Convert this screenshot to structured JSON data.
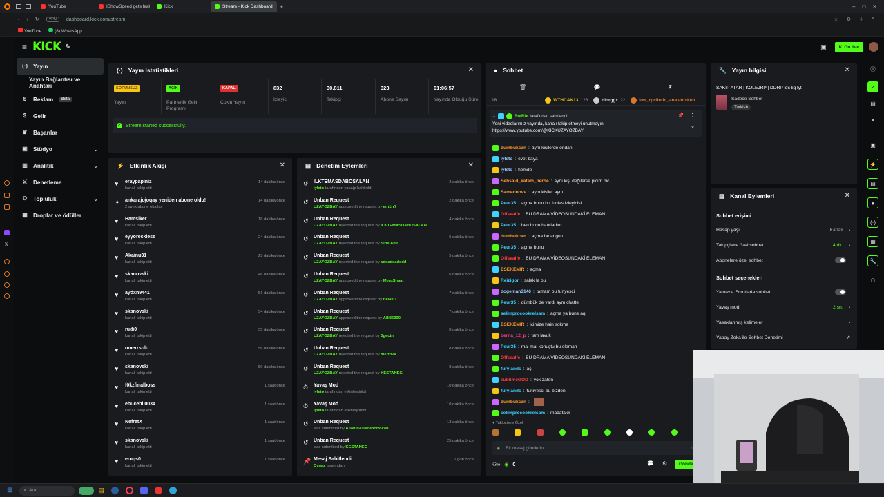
{
  "browser": {
    "tabs": [
      {
        "label": "YouTube",
        "color": "#ff3030"
      },
      {
        "label": "IShowSpeed gets leaked",
        "color": "#ff3030"
      },
      {
        "label": "Kick",
        "color": "#53fc18"
      },
      {
        "label": "Stream - Kick Dashboard",
        "color": "#53fc18"
      }
    ],
    "url": "dashboard.kick.com/stream",
    "bookmarks": [
      "YouTube",
      "(8) WhatsApp"
    ]
  },
  "header": {
    "logo": "KICK",
    "go_live": "Go live"
  },
  "sidebar": {
    "items": [
      {
        "label": "Yayın",
        "icon": "broadcast-icon"
      },
      {
        "label": "Yayın Bağlantısı ve Anahtarı",
        "icon": ""
      },
      {
        "label": "Reklam",
        "icon": "dollar-icon",
        "badge": "Beta"
      },
      {
        "label": "Gelir",
        "icon": "dollar-icon"
      },
      {
        "label": "Başarılar",
        "icon": "trophy-icon"
      },
      {
        "label": "Stüdyo",
        "icon": "studio-icon",
        "chevron": true
      },
      {
        "label": "Analitik",
        "icon": "chart-icon",
        "chevron": true
      },
      {
        "label": "Denetleme",
        "icon": "sword-icon"
      },
      {
        "label": "Topluluk",
        "icon": "people-icon",
        "chevron": true
      },
      {
        "label": "Droplar ve ödüller",
        "icon": "gift-icon"
      }
    ]
  },
  "stats": {
    "title": "Yayın İstatistikleri",
    "items": [
      {
        "badge": "SORUNSUZ",
        "badge_color": "#f5c518",
        "badge_text": "#6b4f00",
        "label": "Yayın"
      },
      {
        "badge": "AÇIK",
        "badge_color": "#53fc18",
        "badge_text": "#0b3a00",
        "label": "Partnerlik Gelir Programı"
      },
      {
        "badge": "KAPALI",
        "badge_color": "#e03030",
        "badge_text": "#ffffff",
        "label": "Çoklu Yayın"
      },
      {
        "value": "832",
        "label": "İzleyici"
      },
      {
        "value": "30.811",
        "label": "Takipçi"
      },
      {
        "value": "323",
        "label": "Abone Sayısı"
      },
      {
        "value": "01:06:57",
        "label": "Yayında Olduğu Süre"
      }
    ],
    "success": "Stream started successfully."
  },
  "activity": {
    "title": "Etkinlik Akışı",
    "rows": [
      {
        "name": "eraypapiniz",
        "sub": "kanalı takip etti",
        "time": "14 dakika önce",
        "icon": "heart"
      },
      {
        "name": "ankarajojoqay yeniden abone oldu!",
        "sub": "2 aylık abone oldular",
        "time": "14 dakika önce",
        "icon": "star"
      },
      {
        "name": "Hamsiker",
        "sub": "kanalı takip etti",
        "time": "18 dakika önce",
        "icon": "heart"
      },
      {
        "name": "eyyoreckless",
        "sub": "kanalı takip etti",
        "time": "24 dakika önce",
        "icon": "heart"
      },
      {
        "name": "Akainu31",
        "sub": "kanalı takip etti",
        "time": "25 dakika önce",
        "icon": "heart"
      },
      {
        "name": "skanovski",
        "sub": "kanalı takip etti",
        "time": "46 dakika önce",
        "icon": "heart"
      },
      {
        "name": "aydxn9441",
        "sub": "kanalı takip etti",
        "time": "51 dakika önce",
        "icon": "heart"
      },
      {
        "name": "skanovski",
        "sub": "kanalı takip etti",
        "time": "54 dakika önce",
        "icon": "heart"
      },
      {
        "name": "rudi0",
        "sub": "kanalı takip etti",
        "time": "55 dakika önce",
        "icon": "heart"
      },
      {
        "name": "omerrsolo",
        "sub": "kanalı takip etti",
        "time": "56 dakika önce",
        "icon": "heart"
      },
      {
        "name": "skanovski",
        "sub": "kanalı takip etti",
        "time": "59 dakika önce",
        "icon": "heart"
      },
      {
        "name": "f0kzfinalboss",
        "sub": "kanalı takip etti",
        "time": "1 saat önce",
        "icon": "heart"
      },
      {
        "name": "ebucehil0034",
        "sub": "kanalı takip etti",
        "time": "1 saat önce",
        "icon": "heart"
      },
      {
        "name": "NefretX",
        "sub": "kanalı takip etti",
        "time": "1 saat önce",
        "icon": "heart"
      },
      {
        "name": "skanovski",
        "sub": "kanalı takip etti",
        "time": "1 saat önce",
        "icon": "heart"
      },
      {
        "name": "eroqs0",
        "sub": "kanalı takip etti",
        "time": "1 saat önce",
        "icon": "heart"
      }
    ]
  },
  "moderation": {
    "title": "Denetim Eylemleri",
    "rows": [
      {
        "name": "ILKTEMASDABOSALAN",
        "who": "iyleto",
        "rest": "tarafından yasağı kaldırıldı",
        "by": "",
        "time": "2 dakika önce"
      },
      {
        "name": "Unban Request",
        "who": "UZAYOZBAY",
        "rest": "approved the request by",
        "by": "em1rr7",
        "time": "2 dakika önce"
      },
      {
        "name": "Unban Request",
        "who": "UZAYOZBAY",
        "rest": "rejected the request by",
        "by": "ILKTEMASDABOSALAN",
        "time": "4 dakika önce"
      },
      {
        "name": "Unban Request",
        "who": "UZAYOZBAY",
        "rest": "rejected the request by",
        "by": "SinsiAbe",
        "time": "5 dakika önce"
      },
      {
        "name": "Unban Request",
        "who": "UZAYOZBAY",
        "rest": "rejected the request by",
        "by": "sdsadsadsdd",
        "time": "5 dakika önce"
      },
      {
        "name": "Unban Request",
        "who": "UZAYOZBAY",
        "rest": "approved the request by",
        "by": "MeruShaat",
        "time": "6 dakika önce"
      },
      {
        "name": "Unban Request",
        "who": "UZAYOZBAY",
        "rest": "approved the request by",
        "by": "belalil1",
        "time": "7 dakika önce"
      },
      {
        "name": "Unban Request",
        "who": "UZAYOZBAY",
        "rest": "approved the request by",
        "by": "Alli35390",
        "time": "7 dakika önce"
      },
      {
        "name": "Unban Request",
        "who": "UZAYOZBAY",
        "rest": "rejected the request by",
        "by": "3gectn",
        "time": "8 dakika önce"
      },
      {
        "name": "Unban Request",
        "who": "UZAYOZBAY",
        "rest": "rejected the request by",
        "by": "mertb24",
        "time": "8 dakika önce"
      },
      {
        "name": "Unban Request",
        "who": "UZAYOZBAY",
        "rest": "rejected the request by",
        "by": "KESTANEG",
        "time": "8 dakika önce"
      },
      {
        "name": "Yavaş Mod",
        "who": "iyleto",
        "rest": "tarafından etkinleştirildi",
        "by": "",
        "time": "10 dakika önce"
      },
      {
        "name": "Yavaş Mod",
        "who": "iyleto",
        "rest": "tarafından etkinleştirildi",
        "by": "",
        "time": "10 dakika önce"
      },
      {
        "name": "Unban Request",
        "who": "",
        "rest": "was submitted by",
        "by": "AllahinAslaniBortocan",
        "time": "13 dakika önce"
      },
      {
        "name": "Unban Request",
        "who": "",
        "rest": "was submitted by",
        "by": "KESTANEG",
        "time": "25 dakika önce"
      },
      {
        "name": "Mesaj Sabitlendi",
        "who": "Cynaz",
        "rest": "tarafından",
        "by": "",
        "time": "1 gün önce"
      }
    ]
  },
  "chat": {
    "title": "Sohbet",
    "count": "18",
    "top_users": [
      {
        "name": "WTHCAN13",
        "n": "126"
      },
      {
        "name": "diorggx",
        "n": "22"
      },
      {
        "name": "low_rpcilerin_anasinisken",
        "n": ""
      }
    ],
    "pinned": {
      "by": "BotRix",
      "by_text": "tarafından sabitlendi",
      "text": "Yeni videolarımız yayında, kanalı takip etmeyi unutmayın!",
      "link": "https://www.youtube.com/@KICKUZAYOZBAY"
    },
    "messages": [
      {
        "name": "dumbukcan",
        "color": "#ff9d2e",
        "text": "aynı kişilerde ondan"
      },
      {
        "name": "iyleto",
        "color": "#9ecbff",
        "text": "evet baya"
      },
      {
        "name": "iyleto",
        "color": "#9ecbff",
        "text": "hemde"
      },
      {
        "name": "Sehsaid_kafam_nerde",
        "color": "#ff9d2e",
        "text": "aynı kişi değilerse picim pic"
      },
      {
        "name": "Samedoovv",
        "color": "#ff9d2e",
        "text": "aynı kişiler aynı"
      },
      {
        "name": "Peur35",
        "color": "#3fd1ff",
        "text": "açma bunu bu funies izleyicisi"
      },
      {
        "name": "Offsealfe",
        "color": "#ff3c3c",
        "text": "BU DRAMA VİDEOSUNDAKİ ELEMAN"
      },
      {
        "name": "Peur35",
        "color": "#3fd1ff",
        "text": "ben bunu hatırladım"
      },
      {
        "name": "dumbukcan",
        "color": "#ff9d2e",
        "text": "açma be angutu"
      },
      {
        "name": "Peur35",
        "color": "#3fd1ff",
        "text": "açma bunu"
      },
      {
        "name": "Offsealfe",
        "color": "#ff3c3c",
        "text": "BU DRAMA VİDEOSUNDAKİ ELEMAN"
      },
      {
        "name": "ESEKEMIR",
        "color": "#ff9d2e",
        "text": "açma"
      },
      {
        "name": "Reizigor",
        "color": "#3fd1ff",
        "text": "salak la bu"
      },
      {
        "name": "dogeman3146",
        "color": "#9ecbff",
        "text": "tamam bu funyesci"
      },
      {
        "name": "Peur35",
        "color": "#3fd1ff",
        "text": "dümbük de vardı aynı chatte"
      },
      {
        "name": "selimprocookrelsam",
        "color": "#3fd1ff",
        "text": "açma ya bune aq"
      },
      {
        "name": "ESEKEMIR",
        "color": "#ff9d2e",
        "text": "icimize hain sokma"
      },
      {
        "name": "berna_12_p",
        "color": "#ff3c8a",
        "text": "tam lavuk"
      },
      {
        "name": "Peur35",
        "color": "#3fd1ff",
        "text": "mal mal konuştu bu eleman"
      },
      {
        "name": "Offsealfe",
        "color": "#ff3c3c",
        "text": "BU DRAMA VİDEOSUNDAKİ ELEMAN"
      },
      {
        "name": "furylands",
        "color": "#3fd1ff",
        "text": "aç"
      },
      {
        "name": "sublimeGOD",
        "color": "#ff3c3c",
        "text": "yok zaten"
      },
      {
        "name": "furylands",
        "color": "#3fd1ff",
        "text": "funiyescl bu bizden"
      },
      {
        "name": "dumbukcan",
        "color": "#ff9d2e",
        "text": ""
      },
      {
        "name": "selimprocookrelsam",
        "color": "#3fd1ff",
        "text": "madafakk"
      }
    ],
    "followers_only": "Takipçilere Özel",
    "input_placeholder": "Bir mesaj gönderin",
    "points": "0",
    "send": "Gönder"
  },
  "stream_info": {
    "title": "Yayın bilgisi",
    "stream_title": "SAKIP ATAR | KOLEJRP | DDRP ldc lig lyt",
    "category": "Sadece Sohbet",
    "tag": "Turkish"
  },
  "channel_actions": {
    "title": "Kanal Eylemleri",
    "section1": "Sohbet erişimi",
    "rows1": [
      {
        "label": "Hesap yaşı",
        "value": "Kapalı",
        "type": "arrow"
      },
      {
        "label": "Takipçilere özel sohbet",
        "value": "4 dk.",
        "type": "arrow",
        "green": true
      },
      {
        "label": "Abonelere özel sohbet",
        "value": "",
        "type": "toggle"
      }
    ],
    "section2": "Sohbet seçenekleri",
    "rows2": [
      {
        "label": "Yalnızca Emotlarla sohbet",
        "value": "",
        "type": "toggle"
      },
      {
        "label": "Yavaş mod",
        "value": "2 sn.",
        "type": "arrow",
        "green": true
      },
      {
        "label": "Yasaklanmış kelimeler",
        "value": "",
        "type": "arrow"
      },
      {
        "label": "Yapay Zeka ile Sohbet Denetimi",
        "value": "",
        "type": "ext"
      }
    ]
  },
  "taskbar": {
    "search_placeholder": "Ara"
  }
}
